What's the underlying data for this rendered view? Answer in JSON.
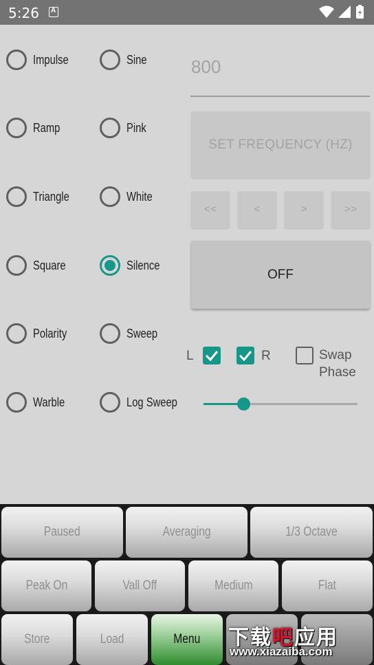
{
  "status_bar": {
    "time": "5:26"
  },
  "waveforms": {
    "left": [
      {
        "label": "Impulse",
        "checked": false
      },
      {
        "label": "Ramp",
        "checked": false
      },
      {
        "label": "Triangle",
        "checked": false
      },
      {
        "label": "Square",
        "checked": false
      },
      {
        "label": "Polarity",
        "checked": false
      },
      {
        "label": "Warble",
        "checked": false
      }
    ],
    "right": [
      {
        "label": "Sine",
        "checked": false
      },
      {
        "label": "Pink",
        "checked": false
      },
      {
        "label": "White",
        "checked": false
      },
      {
        "label": "Silence",
        "checked": true
      },
      {
        "label": "Sweep",
        "checked": false
      },
      {
        "label": "Log Sweep",
        "checked": false
      }
    ]
  },
  "frequency": {
    "placeholder": "800",
    "set_button_label": "SET FREQUENCY (HZ)",
    "step_buttons": [
      "<<",
      "<",
      ">",
      ">>"
    ]
  },
  "power_button_label": "OFF",
  "channels": {
    "left_label": "L",
    "left_checked": true,
    "right_label": "R",
    "right_checked": true,
    "swap_phase_label_line1": "Swap",
    "swap_phase_label_line2": "Phase",
    "swap_phase_checked": false
  },
  "volume_slider": {
    "value_fraction": 0.26
  },
  "bottom_controls": {
    "row1": [
      "Paused",
      "Averaging",
      "1/3 Octave"
    ],
    "row2": [
      "Peak On",
      "Vall Off",
      "Medium",
      "Flat"
    ],
    "row3": [
      "Store",
      "Load",
      "Menu",
      "",
      ""
    ]
  },
  "watermark": {
    "line1_a": "下载",
    "line1_b": "吧",
    "line1_c": "应用",
    "line2": "www.xiazaiba.com"
  },
  "colors": {
    "accent": "#17978a",
    "menu_green": "#2f8b2f"
  }
}
